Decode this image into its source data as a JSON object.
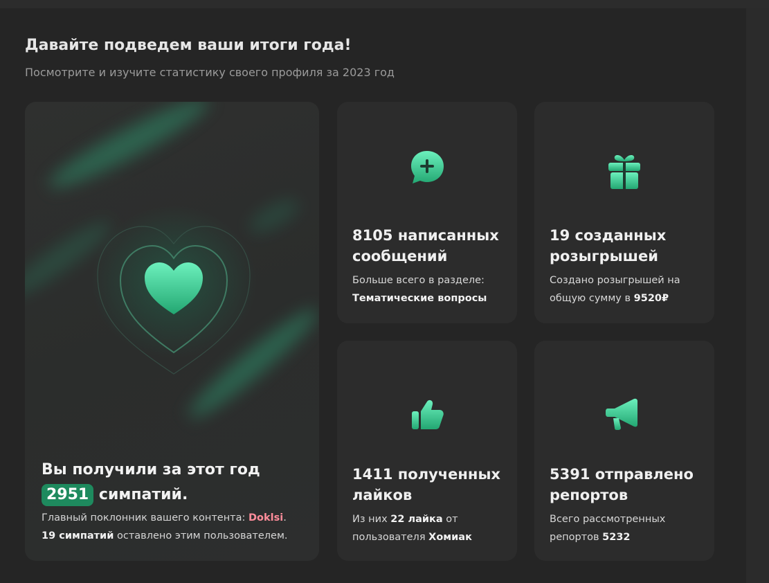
{
  "header": {
    "title": "Давайте подведем ваши итоги года!",
    "subtitle": "Посмотрите и изучите статистику своего профиля за 2023 год"
  },
  "likes_card": {
    "icon": "heart-icon",
    "line1": "Вы получили за этот год",
    "count": "2951",
    "count_suffix": "симпатий.",
    "fan_prefix": "Главный поклонник вашего контента: ",
    "fan_name": "Doklsi",
    "fan_dot": ".",
    "fan_count": "19 симпатий",
    "fan_suffix": " оставлено этим пользователем."
  },
  "messages_card": {
    "icon": "chat-plus-icon",
    "title": "8105 написанных сообщений",
    "desc_prefix": "Больше всего в разделе:",
    "desc_bold": "Тематические вопросы"
  },
  "giveaways_card": {
    "icon": "gift-icon",
    "title": "19 созданных розыгрышей",
    "desc_prefix": "Создано розыгрышей на общую сумму в ",
    "desc_bold": "9520₽"
  },
  "received_likes_card": {
    "icon": "thumbs-up-icon",
    "title": "1411 полученных лайков",
    "desc_prefix": "Из них ",
    "desc_bold1": "22 лайка",
    "desc_mid": " от пользователя ",
    "desc_bold2": "Хомиак"
  },
  "reports_card": {
    "icon": "megaphone-icon",
    "title": "5391 отправлено репортов",
    "desc_prefix": "Всего рассмотренных репортов ",
    "desc_bold": "5232"
  },
  "colors": {
    "accent": "#1e8a5e",
    "accent_light": "#4fe0a6",
    "fan_name": "#ff8d9b",
    "background": "#252525",
    "card": "#2c2c2c"
  }
}
